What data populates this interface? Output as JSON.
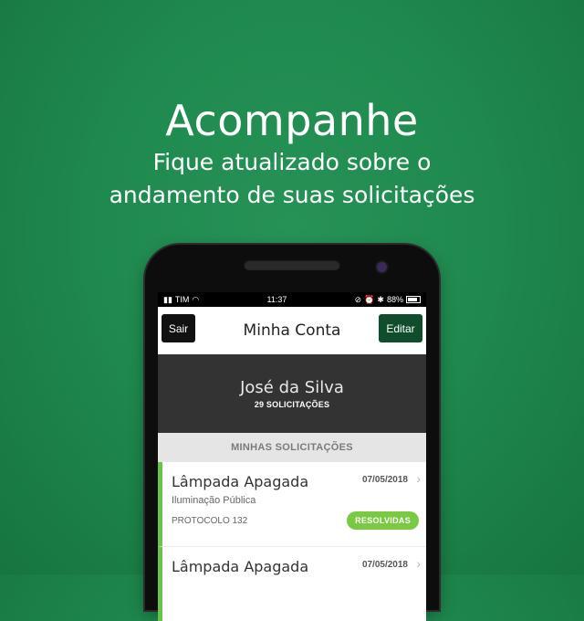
{
  "hero": {
    "title": "Acompanhe",
    "subtitle_line1": "Fique atualizado sobre o",
    "subtitle_line2": "andamento de suas solicitações"
  },
  "statusbar": {
    "carrier": "TIM",
    "time": "11:37",
    "battery": "88%"
  },
  "navbar": {
    "left_button": "Sair",
    "title": "Minha Conta",
    "right_button": "Editar"
  },
  "profile": {
    "name": "José da Silva",
    "count": "29 SOLICITAÇÕES"
  },
  "section": {
    "header": "MINHAS SOLICITAÇÕES"
  },
  "requests": [
    {
      "title": "Lâmpada Apagada",
      "category": "Iluminação Pública",
      "protocol": "PROTOCOLO 132",
      "date": "07/05/2018",
      "status": "RESOLVIDAS"
    },
    {
      "title": "Lâmpada Apagada",
      "date": "07/05/2018"
    }
  ],
  "colors": {
    "background": "#1f8a4f",
    "accent_green": "#6cc24a",
    "edit_button": "#0f4d2c",
    "profile_bg": "#333333"
  }
}
